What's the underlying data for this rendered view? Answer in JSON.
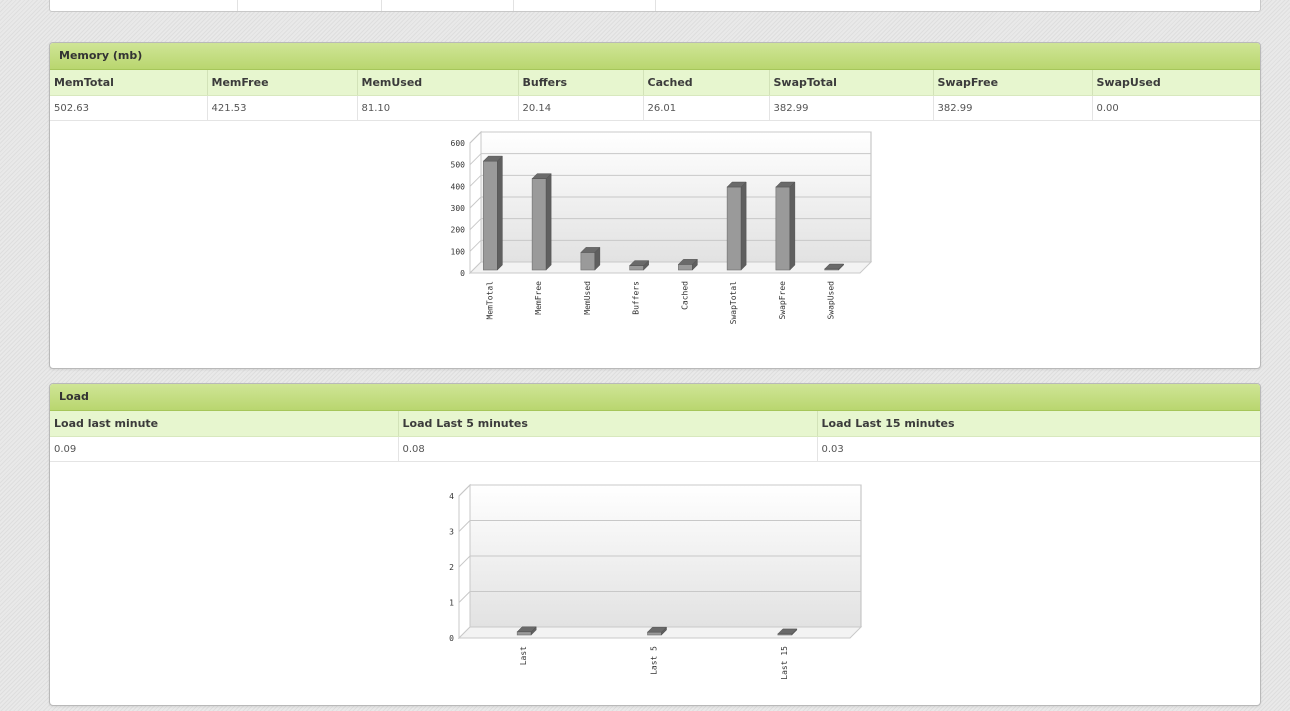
{
  "memory": {
    "title": "Memory (mb)",
    "columns": [
      "MemTotal",
      "MemFree",
      "MemUsed",
      "Buffers",
      "Cached",
      "SwapTotal",
      "SwapFree",
      "SwapUsed"
    ],
    "values": [
      "502.63",
      "421.53",
      "81.10",
      "20.14",
      "26.01",
      "382.99",
      "382.99",
      "0.00"
    ]
  },
  "load": {
    "title": "Load",
    "columns": [
      "Load last minute",
      "Load Last 5 minutes",
      "Load Last 15 minutes"
    ],
    "values": [
      "0.09",
      "0.08",
      "0.03"
    ]
  },
  "chart_data": [
    {
      "type": "bar",
      "title": "",
      "categories": [
        "MemTotal",
        "MemFree",
        "MemUsed",
        "Buffers",
        "Cached",
        "SwapTotal",
        "SwapFree",
        "SwapUsed"
      ],
      "values": [
        502.63,
        421.53,
        81.1,
        20.14,
        26.01,
        382.99,
        382.99,
        0.0
      ],
      "yticks": [
        0,
        100,
        200,
        300,
        400,
        500,
        600
      ],
      "ylim": [
        0,
        600
      ],
      "grid": true,
      "bar_color": "#9a9a9a"
    },
    {
      "type": "bar",
      "title": "",
      "categories": [
        "Last",
        "Last 5",
        "Last 15"
      ],
      "values": [
        0.09,
        0.08,
        0.03
      ],
      "yticks": [
        0,
        1,
        2,
        3,
        4
      ],
      "ylim": [
        0,
        4
      ],
      "grid": true,
      "bar_color": "#9a9a9a"
    }
  ]
}
